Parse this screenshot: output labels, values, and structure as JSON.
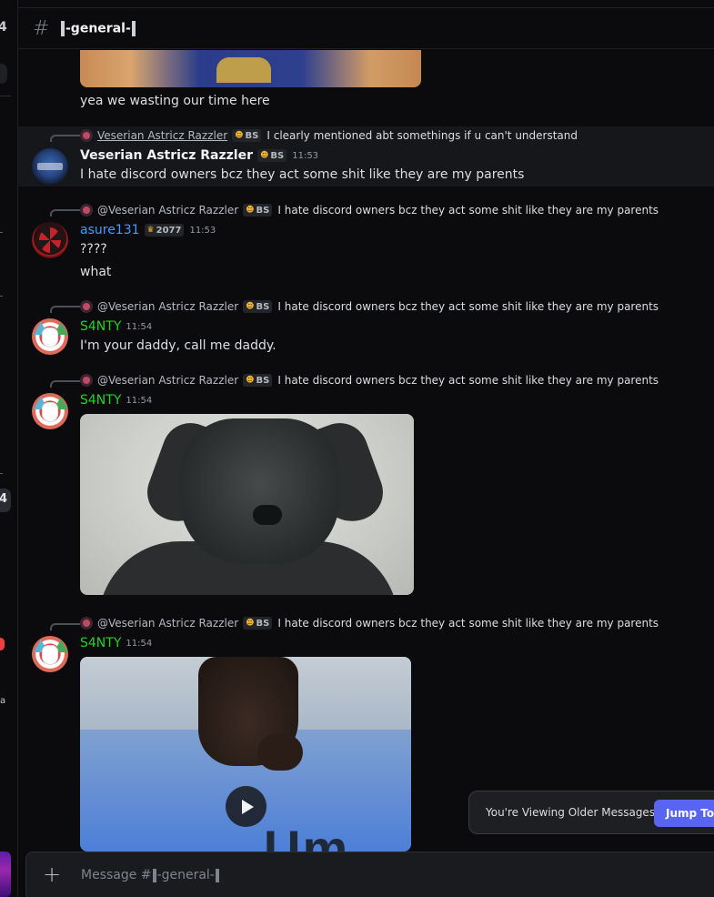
{
  "channel": {
    "name": "-general-",
    "placeholder_prefix": "Message #",
    "placeholder_name": "-general-"
  },
  "rail": {
    "top_glyph": "4",
    "mid_glyph": "4",
    "letter": "a"
  },
  "icons": [
    "hash-icon",
    "plus-icon",
    "play-icon",
    "reply-avatar-icon"
  ],
  "colors": {
    "accent": "#5865f2",
    "green_name": "#23d323",
    "blue_name": "#3f9dff"
  },
  "messages": [
    {
      "id": "m0",
      "text": "yea we wasting our time here"
    },
    {
      "id": "m1",
      "reply": {
        "name": "Veserian Astricz Razzler",
        "tag": "BS",
        "text": "I clearly mentioned abt somethings if u can't understand"
      },
      "author": "Veserian Astricz Razzler",
      "tag": "BS",
      "time": "11:53",
      "lines": [
        "I hate discord owners bcz they act some shit like they are my parents"
      ]
    },
    {
      "id": "m2",
      "reply": {
        "name": "@Veserian Astricz Razzler",
        "tag": "BS",
        "text": "I hate discord owners bcz they act some shit like they are my parents"
      },
      "author": "asure131",
      "tag": "2077",
      "time": "11:53",
      "lines": [
        "????",
        "what"
      ]
    },
    {
      "id": "m3",
      "reply": {
        "name": "@Veserian Astricz Razzler",
        "tag": "BS",
        "text": "I hate discord owners bcz they act some shit like they are my parents"
      },
      "author": "S4NTY",
      "time": "11:54",
      "lines": [
        "I'm your daddy, call me daddy."
      ]
    },
    {
      "id": "m4",
      "reply": {
        "name": "@Veserian Astricz Razzler",
        "tag": "BS",
        "text": "I hate discord owners bcz they act some shit like they are my parents"
      },
      "author": "S4NTY",
      "time": "11:54"
    },
    {
      "id": "m5",
      "reply": {
        "name": "@Veserian Astricz Razzler",
        "tag": "BS",
        "text": "I hate discord owners bcz they act some shit like they are my parents"
      },
      "author": "S4NTY",
      "time": "11:54",
      "video_text": "Um"
    }
  ],
  "older_banner": {
    "text": "You're Viewing Older Messages",
    "button": "Jump To Present"
  }
}
